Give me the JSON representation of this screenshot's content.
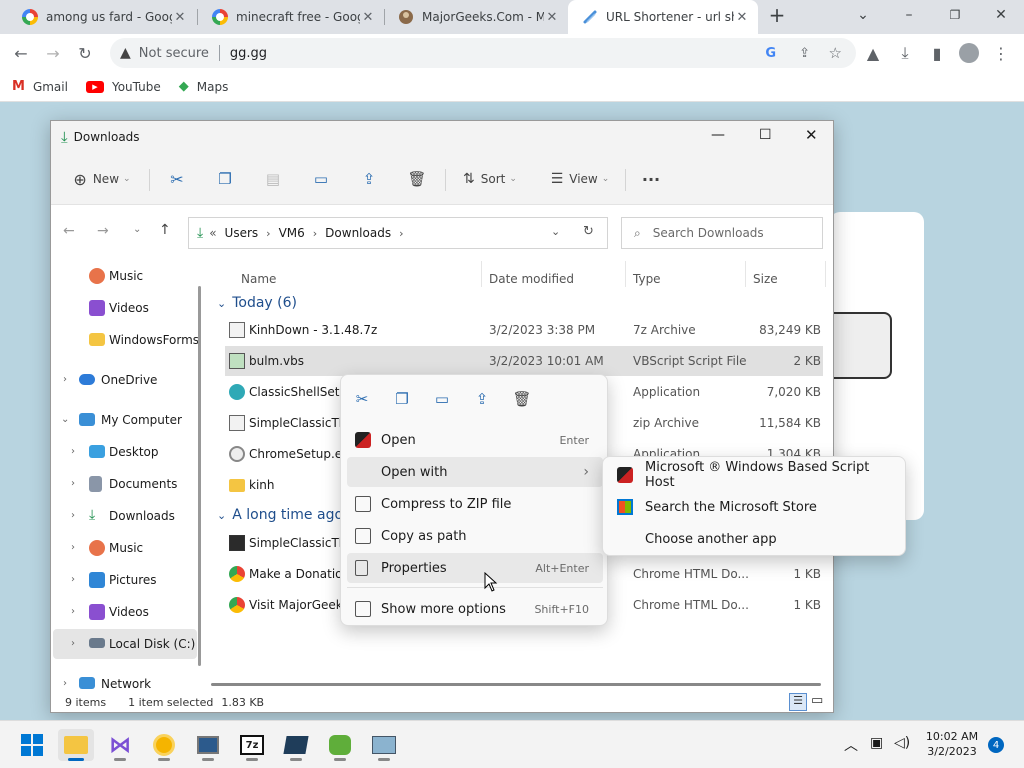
{
  "browser": {
    "tabs": [
      {
        "title": "among us fard - Googl"
      },
      {
        "title": "minecraft free - Googl"
      },
      {
        "title": "MajorGeeks.Com - Maj"
      },
      {
        "title": "URL Shortener - url sh"
      }
    ],
    "security_label": "Not secure",
    "url": "gg.gg",
    "bookmarks": [
      "Gmail",
      "YouTube",
      "Maps"
    ]
  },
  "explorer": {
    "title": "Downloads",
    "commands": {
      "new": "New",
      "sort": "Sort",
      "view": "View",
      "more": "···"
    },
    "address": {
      "prefix": "«",
      "crumbs": [
        "Users",
        "VM6",
        "Downloads"
      ]
    },
    "search_placeholder": "Search Downloads",
    "nav": [
      {
        "label": "Music"
      },
      {
        "label": "Videos"
      },
      {
        "label": "WindowsForms"
      },
      {
        "label": "OneDrive"
      },
      {
        "label": "My Computer"
      },
      {
        "label": "Desktop"
      },
      {
        "label": "Documents"
      },
      {
        "label": "Downloads"
      },
      {
        "label": "Music"
      },
      {
        "label": "Pictures"
      },
      {
        "label": "Videos"
      },
      {
        "label": "Local Disk (C:)"
      },
      {
        "label": "Network"
      }
    ],
    "columns": {
      "name": "Name",
      "date": "Date modified",
      "type": "Type",
      "size": "Size"
    },
    "groups": {
      "today": "Today (6)",
      "older": "A long time ago"
    },
    "files_today": [
      {
        "name": "KinhDown - 3.1.48.7z",
        "date": "3/2/2023 3:38 PM",
        "type": "7z Archive",
        "size": "83,249 KB"
      },
      {
        "name": "bulm.vbs",
        "date": "3/2/2023 10:01 AM",
        "type": "VBScript Script File",
        "size": "2 KB"
      },
      {
        "name": "ClassicShellSetup",
        "date": "",
        "type": "Application",
        "size": "7,020 KB"
      },
      {
        "name": "SimpleClassicThe",
        "date": "",
        "type": "zip Archive",
        "size": "11,584 KB"
      },
      {
        "name": "ChromeSetup.ex",
        "date": "",
        "type": "Application",
        "size": "1,304 KB"
      },
      {
        "name": "kinh",
        "date": "",
        "type": "",
        "size": ""
      }
    ],
    "files_older": [
      {
        "name": "SimpleClassicThe",
        "date": "",
        "type": "",
        "size": ""
      },
      {
        "name": "Make a Donatio",
        "date": "",
        "type": "Chrome HTML Do...",
        "size": "1 KB"
      },
      {
        "name": "Visit MajorGeeks.",
        "date": "",
        "type": "Chrome HTML Do...",
        "size": "1 KB"
      }
    ],
    "status": {
      "items": "9 items",
      "selected": "1 item selected",
      "size": "1.83 KB"
    }
  },
  "context_menu": {
    "items": [
      {
        "label": "Open",
        "shortcut": "Enter"
      },
      {
        "label": "Open with",
        "shortcut": "›"
      },
      {
        "label": "Compress to ZIP file",
        "shortcut": ""
      },
      {
        "label": "Copy as path",
        "shortcut": ""
      },
      {
        "label": "Properties",
        "shortcut": "Alt+Enter"
      },
      {
        "label": "Show more options",
        "shortcut": "Shift+F10"
      }
    ]
  },
  "submenu": {
    "items": [
      {
        "label": "Microsoft ® Windows Based Script Host"
      },
      {
        "label": "Search the Microsoft Store"
      },
      {
        "label": "Choose another app"
      }
    ]
  },
  "taskbar": {
    "time": "10:02 AM",
    "date": "3/2/2023",
    "notifications": "4"
  }
}
